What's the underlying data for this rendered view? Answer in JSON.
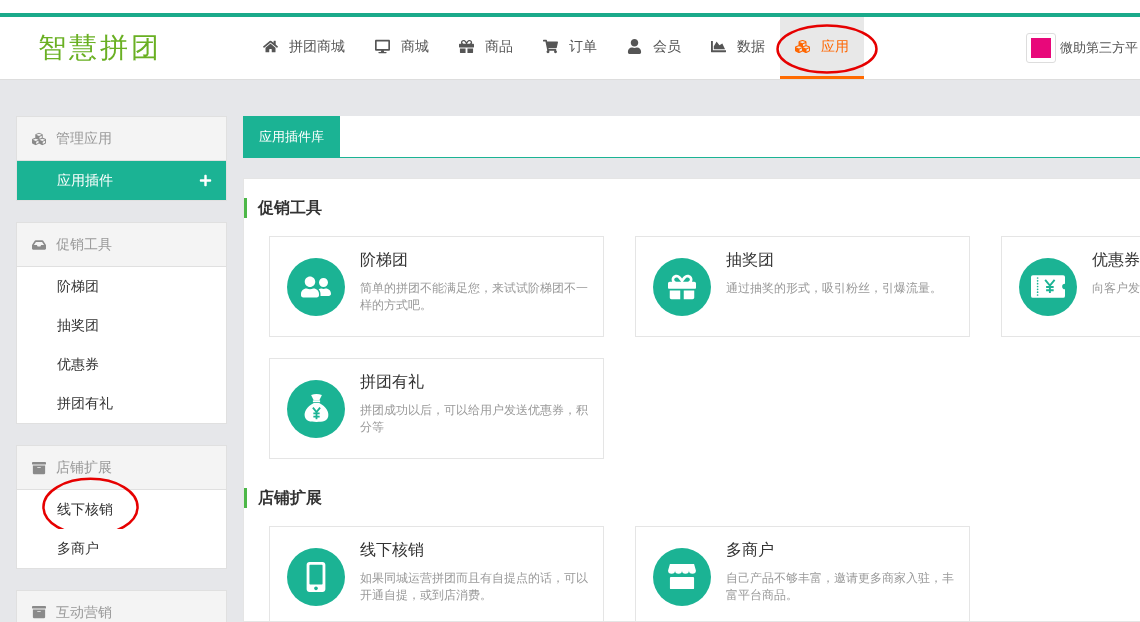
{
  "header": {
    "logo": "智慧拼团",
    "nav": [
      {
        "label": "拼团商城",
        "selected": false,
        "circled": false
      },
      {
        "label": "商城",
        "selected": false,
        "circled": false
      },
      {
        "label": "商品",
        "selected": false,
        "circled": false
      },
      {
        "label": "订单",
        "selected": false,
        "circled": false
      },
      {
        "label": "会员",
        "selected": false,
        "circled": false
      },
      {
        "label": "数据",
        "selected": false,
        "circled": false
      },
      {
        "label": "应用",
        "selected": true,
        "circled": true
      }
    ],
    "account": "微助第三方平"
  },
  "sidebar": [
    {
      "title": "管理应用",
      "items": [
        {
          "label": "应用插件",
          "selected": true,
          "circled": false
        }
      ]
    },
    {
      "title": "促销工具",
      "items": [
        {
          "label": "阶梯团",
          "selected": false,
          "circled": false
        },
        {
          "label": "抽奖团",
          "selected": false,
          "circled": false
        },
        {
          "label": "优惠券",
          "selected": false,
          "circled": false
        },
        {
          "label": "拼团有礼",
          "selected": false,
          "circled": false
        }
      ]
    },
    {
      "title": "店铺扩展",
      "items": [
        {
          "label": "线下核销",
          "selected": false,
          "circled": true
        },
        {
          "label": "多商户",
          "selected": false,
          "circled": false
        }
      ]
    },
    {
      "title": "互动营销"
    }
  ],
  "tabs": [
    {
      "label": "应用插件库",
      "selected": true
    }
  ],
  "sections": [
    {
      "title": "促销工具",
      "plugins": [
        {
          "title": "阶梯团",
          "description": "简单的拼团不能满足您，来试试阶梯团不一样的方式吧。"
        },
        {
          "title": "抽奖团",
          "description": "通过抽奖的形式，吸引粉丝，引爆流量。"
        },
        {
          "title": "优惠券",
          "description": "向客户发"
        },
        {
          "title": "拼团有礼",
          "description": "拼团成功以后，可以给用户发送优惠券，积分等"
        }
      ]
    },
    {
      "title": "店铺扩展",
      "plugins": [
        {
          "title": "线下核销",
          "description": "如果同城运营拼团而且有自提点的话，可以开通自提，或到店消费。"
        },
        {
          "title": "多商户",
          "description": "自己产品不够丰富，邀请更多商家入驻，丰富平台商品。"
        }
      ]
    }
  ]
}
